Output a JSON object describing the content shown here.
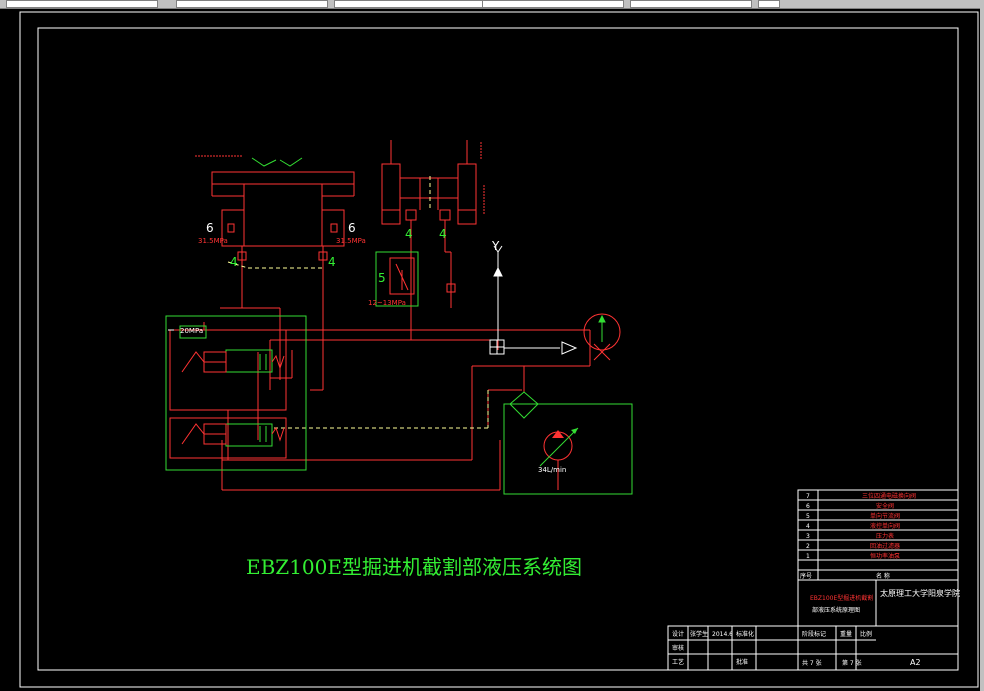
{
  "drawing_title": "EBZ100E型掘进机截割部液压系统图",
  "labels": {
    "valve_left_no": "6",
    "valve_right_no": "6",
    "pressure_left": "31.5MPa",
    "pressure_right": "31.5MPa",
    "check_left": "4",
    "check_right": "4",
    "top_check_left": "4",
    "top_check_right": "4",
    "relief_no": "5",
    "relief_pressure": "12~13MPa",
    "control_pressure": "20MPa",
    "pump_flow": "34L/min",
    "exhaust_mark": "Y"
  },
  "title_block": {
    "parts_header_no": "序号",
    "parts_header_name": "名  称",
    "parts": [
      {
        "no": "7",
        "name": "三位四通电磁换向阀"
      },
      {
        "no": "6",
        "name": "安全阀"
      },
      {
        "no": "5",
        "name": "单向节流阀"
      },
      {
        "no": "4",
        "name": "液控单向阀"
      },
      {
        "no": "3",
        "name": "压力表"
      },
      {
        "no": "2",
        "name": "回油过滤器"
      },
      {
        "no": "1",
        "name": "恒功率油泵"
      }
    ],
    "drawing_name_line1": "EBZ100E型掘进机截割",
    "drawing_name_line2": "部液压系统原理图",
    "school": "太原理工大学阳泉学院",
    "sheet_size": "A2",
    "sign_rows": [
      "设计",
      "审核",
      "工艺"
    ],
    "designer": "张学生",
    "design_date": "2014.6",
    "std": "标准化",
    "approve": "批准",
    "stage_label": "阶段标记",
    "weight_label": "重量",
    "scale_label": "比例",
    "sheets_total": "共 7 张",
    "sheet_no": "第 7 张"
  },
  "colors": {
    "background": "#000000",
    "frame": "#ffffff",
    "hydraulic_line": "#ff3333",
    "pilot_line": "#ffffff",
    "dashed_line": "#ffff99",
    "component_box": "#33dd33",
    "title_text": "#33ee33"
  }
}
